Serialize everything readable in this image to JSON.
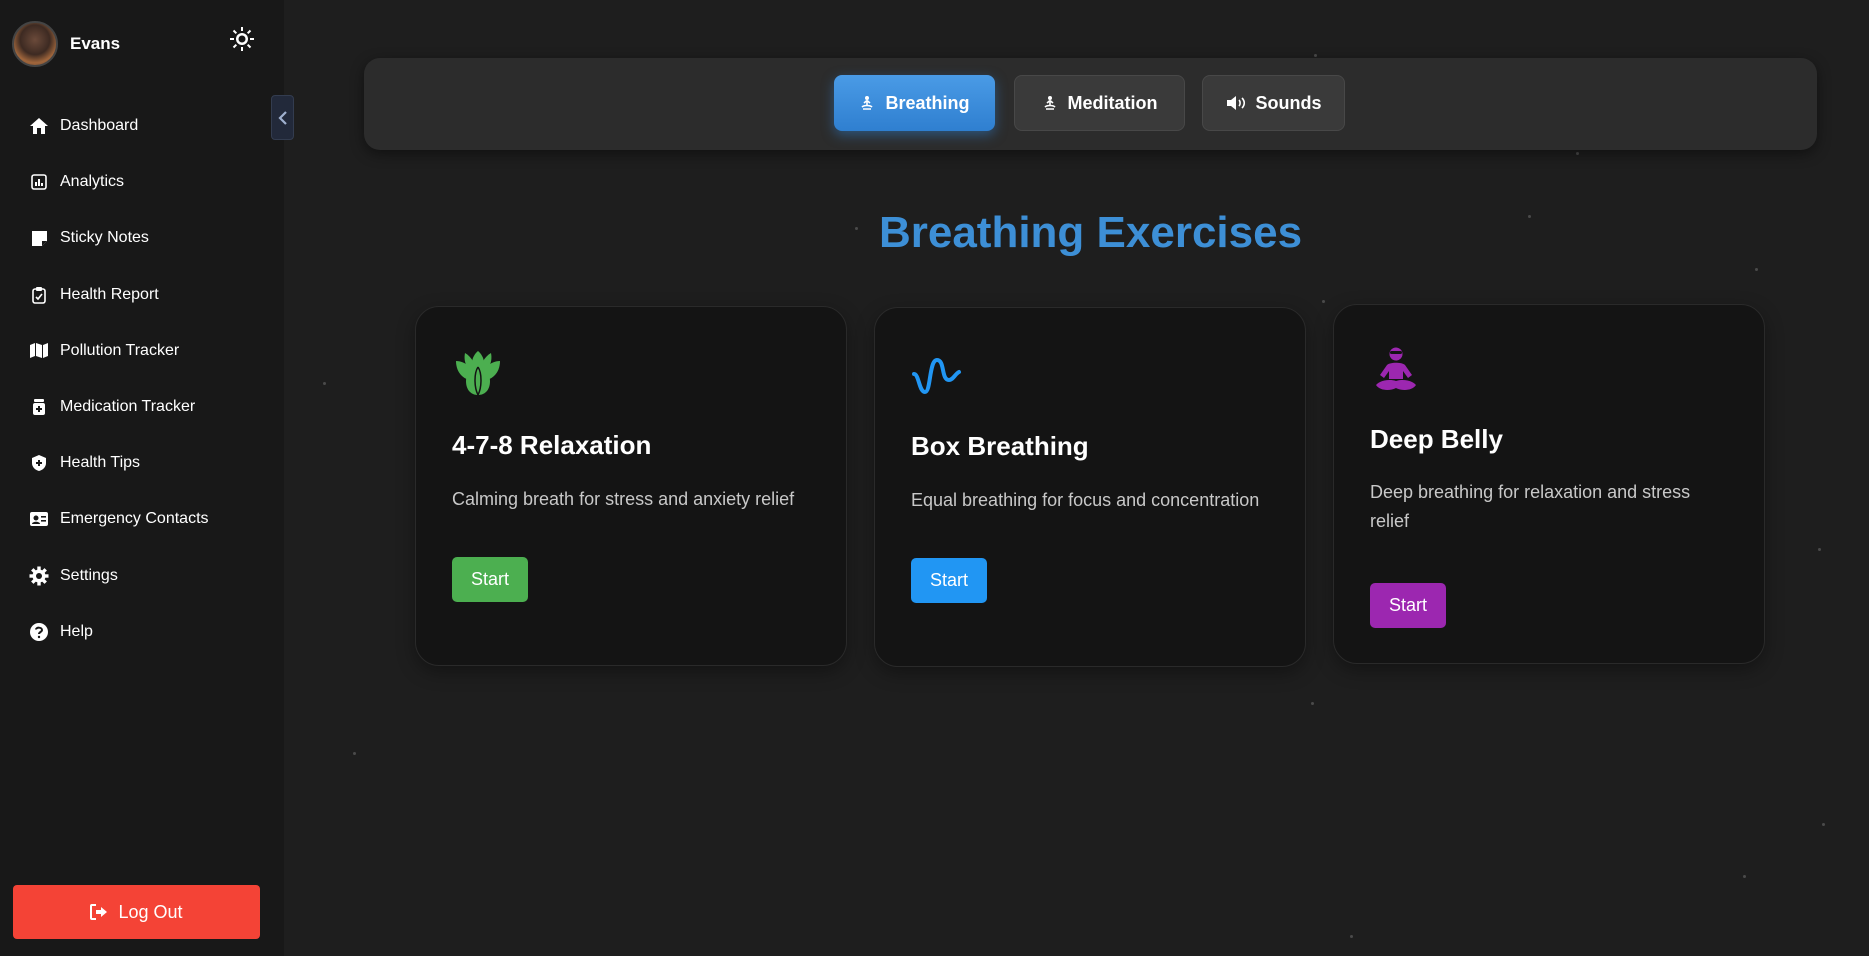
{
  "user": {
    "name": "Evans"
  },
  "sidebar": {
    "items": [
      {
        "label": "Dashboard",
        "icon": "home-icon"
      },
      {
        "label": "Analytics",
        "icon": "analytics-icon"
      },
      {
        "label": "Sticky Notes",
        "icon": "sticky-note-icon"
      },
      {
        "label": "Health Report",
        "icon": "clipboard-icon"
      },
      {
        "label": "Pollution Tracker",
        "icon": "map-icon"
      },
      {
        "label": "Medication Tracker",
        "icon": "medication-icon"
      },
      {
        "label": "Health Tips",
        "icon": "shield-icon"
      },
      {
        "label": "Emergency Contacts",
        "icon": "contact-card-icon"
      },
      {
        "label": "Settings",
        "icon": "gear-icon"
      },
      {
        "label": "Help",
        "icon": "help-icon"
      }
    ],
    "logout_label": "Log Out"
  },
  "tabs": [
    {
      "label": "Breathing",
      "active": true
    },
    {
      "label": "Meditation",
      "active": false
    },
    {
      "label": "Sounds",
      "active": false
    }
  ],
  "section": {
    "title": "Breathing Exercises"
  },
  "exercises": [
    {
      "title": "4-7-8 Relaxation",
      "description": "Calming breath for stress and anxiety relief",
      "button": "Start",
      "icon": "lotus-icon",
      "color": "#4caf50"
    },
    {
      "title": "Box Breathing",
      "description": "Equal breathing for focus and concentration",
      "button": "Start",
      "icon": "wave-icon",
      "color": "#2196f3"
    },
    {
      "title": "Deep Belly",
      "description": "Deep breathing for relaxation and stress relief",
      "button": "Start",
      "icon": "meditation-icon",
      "color": "#9c27b0"
    }
  ],
  "colors": {
    "accent": "#3d8fd6",
    "logout": "#f44336",
    "background": "#1e1e1e",
    "sidebar": "#181818"
  }
}
